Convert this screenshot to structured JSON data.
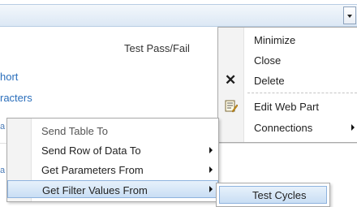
{
  "webpart": {
    "column_header": "Test Pass/Fail",
    "link_1": "hort",
    "link_2": "racters",
    "partial_1": "a",
    "partial_2": "a"
  },
  "web_part_menu": {
    "items": [
      {
        "label": "Minimize",
        "icon": ""
      },
      {
        "label": "Close",
        "icon": ""
      },
      {
        "label": "Delete",
        "icon": "delete-x-icon"
      },
      {
        "label": "Edit Web Part",
        "icon": "edit-web-part-icon"
      },
      {
        "label": "Connections",
        "icon": "",
        "has_submenu": true
      }
    ]
  },
  "connections_menu": {
    "items": [
      {
        "label": "Send Table To",
        "enabled": false
      },
      {
        "label": "Send Row of Data To",
        "has_submenu": true
      },
      {
        "label": "Get Parameters From",
        "has_submenu": true
      },
      {
        "label": "Get Filter Values From",
        "has_submenu": true,
        "selected": true
      }
    ]
  },
  "filter_menu": {
    "items": [
      {
        "label": "Test Cycles",
        "selected": true
      }
    ]
  },
  "colors": {
    "link": "#2a6ebb",
    "highlight": "#c9def4",
    "highlight_border": "#8eb3de",
    "menu_border": "#a9a9a9"
  }
}
